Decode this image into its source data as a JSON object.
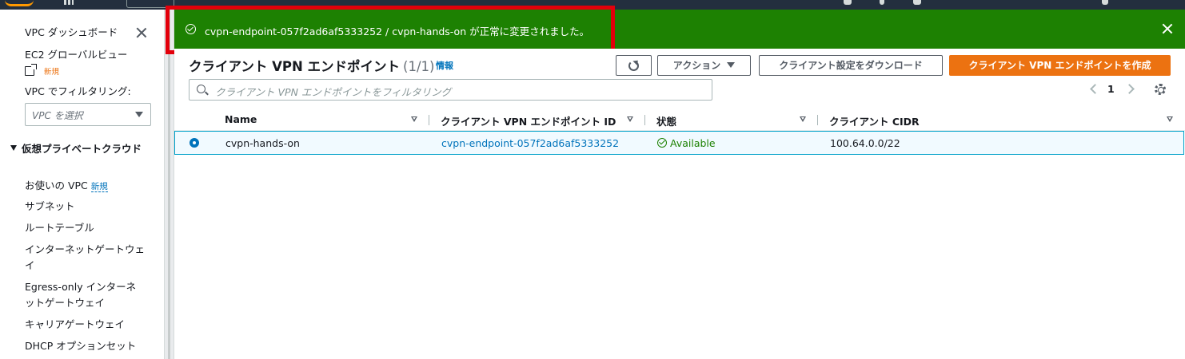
{
  "sidebar": {
    "items": [
      {
        "label": "VPC ダッシュボード"
      },
      {
        "label": "EC2 グローバルビュー"
      },
      {
        "label": "新規"
      },
      {
        "label": "VPC でフィルタリング:"
      },
      {
        "label": "VPC を選択"
      },
      {
        "label": "仮想プライベートクラウド"
      },
      {
        "label": "お使いの VPC"
      },
      {
        "label": "新規"
      },
      {
        "label": "サブネット"
      },
      {
        "label": "ルートテーブル"
      },
      {
        "label": "インターネットゲートウェイ"
      },
      {
        "label": "Egress-only インターネットゲートウェイ"
      },
      {
        "label": "キャリアゲートウェイ"
      },
      {
        "label": "DHCP オプションセット"
      }
    ]
  },
  "flash": {
    "message": "cvpn-endpoint-057f2ad6af5333252 / cvpn-hands-on が正常に変更されました。",
    "color": "#1d8102"
  },
  "main": {
    "title": "クライアント VPN エンドポイント",
    "count": "(1/1)",
    "info": "情報",
    "actions_label": "アクション",
    "download_label": "クライアント設定をダウンロード",
    "create_label": "クライアント VPN エンドポイントを作成",
    "filter_placeholder": "クライアント VPN エンドポイントをフィルタリング",
    "page": "1"
  },
  "table": {
    "columns": [
      "Name",
      "クライアント VPN エンドポイント ID",
      "状態",
      "クライアント CIDR"
    ],
    "rows": [
      {
        "name": "cvpn-hands-on",
        "id": "cvpn-endpoint-057f2ad6af5333252",
        "status": "Available",
        "cidr": "100.64.0.0/22"
      }
    ]
  },
  "colors": {
    "accent": "#ec7211",
    "link": "#0073bb",
    "topbar": "#232f3e",
    "highlight": "#e3000b"
  }
}
